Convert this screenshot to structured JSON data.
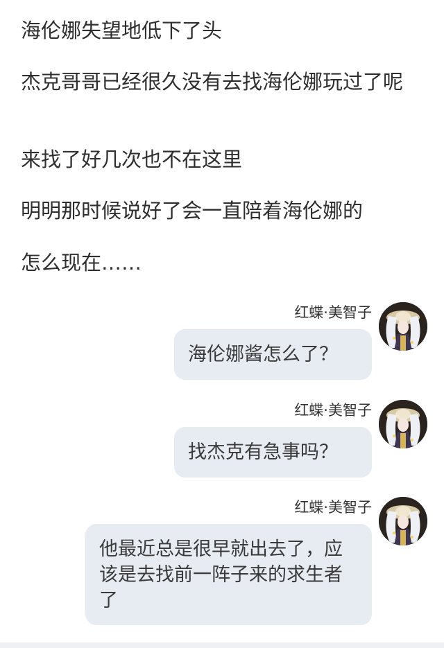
{
  "narration": [
    "海伦娜失望地低下了头",
    "杰克哥哥已经很久没有去找海伦娜玩过了呢",
    "来找了好几次也不在这里",
    "明明那时候说好了会一直陪着海伦娜的",
    "怎么现在……"
  ],
  "messages": [
    {
      "sender": "红蝶·美智子",
      "text": "海伦娜酱怎么了？",
      "avatar": "michiko-avatar"
    },
    {
      "sender": "红蝶·美智子",
      "text": "找杰克有急事吗？",
      "avatar": "michiko-avatar"
    },
    {
      "sender": "红蝶·美智子",
      "text": "他最近总是很早就出去了，应该是去找前一阵子来的求生者了",
      "avatar": "michiko-avatar"
    }
  ],
  "colors": {
    "bubble_bg": "#e7ebf2",
    "text": "#2e2e2e"
  }
}
